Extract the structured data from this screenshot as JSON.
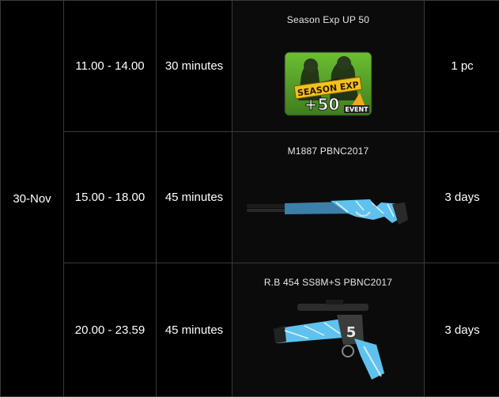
{
  "date": "30-Nov",
  "rows": [
    {
      "time": "11.00 - 14.00",
      "duration": "30 minutes",
      "item": "Season Exp UP 50",
      "quantity": "1 pc",
      "icon": "season-exp-icon",
      "badge_title": "SEASON EXP",
      "badge_value": "+50",
      "badge_tag": "EVENT"
    },
    {
      "time": "15.00 - 18.00",
      "duration": "45 minutes",
      "item": "M1887 PBNC2017",
      "quantity": "3 days",
      "icon": "shotgun-icon"
    },
    {
      "time": "20.00 - 23.59",
      "duration": "45 minutes",
      "item": "R.B 454 SS8M+S PBNC2017",
      "quantity": "3 days",
      "icon": "revolver-icon"
    }
  ],
  "colors": {
    "background": "#000000",
    "border": "#3a3a3a",
    "accent_blue": "#4fb8e6",
    "exp_green": "#5aa82a",
    "exp_yellow": "#f2c21b"
  }
}
